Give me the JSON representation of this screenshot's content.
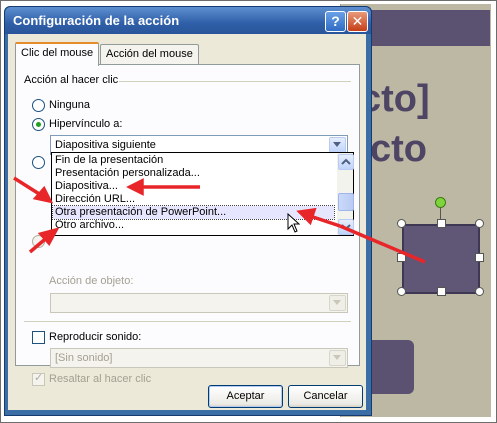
{
  "slide": {
    "heading_line1": "cto]",
    "heading_line2": "cto"
  },
  "dialog": {
    "title": "Configuración de la acción",
    "help_glyph": "?",
    "close_glyph": "✕",
    "tabs": [
      {
        "label": "Clic del mouse",
        "active": true
      },
      {
        "label": "Acción del mouse",
        "active": false
      }
    ],
    "section_label": "Acción al hacer clic",
    "options": {
      "none": "Ninguna",
      "hyperlink": "Hipervínculo a:",
      "object_action": "Acción de objeto:"
    },
    "hyperlink_value": "Diapositiva siguiente",
    "dropdown_items": [
      "Fin de la presentación",
      "Presentación personalizada...",
      "Diapositiva...",
      "Dirección URL...",
      "Otra presentación de PowerPoint...",
      "Otro archivo..."
    ],
    "selected_dropdown_item": "Otra presentación de PowerPoint...",
    "play_sound": "Reproducir sonido:",
    "sound_value": "[Sin sonido]",
    "highlight": "Resaltar al hacer clic",
    "buttons": {
      "ok": "Aceptar",
      "cancel": "Cancelar"
    }
  },
  "colors": {
    "titlebar": "#2f5fa8",
    "annotation_arrows": "#e8262a",
    "slide_accent": "#5a5270"
  }
}
